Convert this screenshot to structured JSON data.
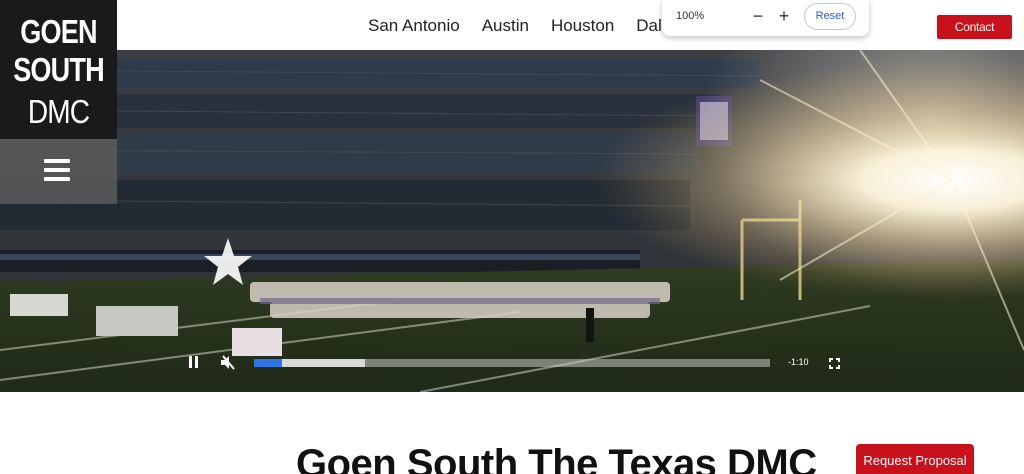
{
  "logo": {
    "line1": "GOEN",
    "line2": "SOUTH",
    "line3": "DMC"
  },
  "nav": {
    "items": [
      "San Antonio",
      "Austin",
      "Houston",
      "Dallas"
    ]
  },
  "zoom": {
    "level": "100%",
    "minus": "−",
    "plus": "+",
    "reset": "Reset"
  },
  "header": {
    "contact": "Contact"
  },
  "video": {
    "time_remaining": "-1:10",
    "progress_played": 0.055,
    "progress_buffered": 0.215,
    "controls": {
      "play": "pause-icon",
      "mute": "muted-speaker-icon",
      "fullscreen": "fullscreen-icon"
    }
  },
  "main": {
    "headline": "Goen South The Texas DMC",
    "cta": "Request Proposal"
  },
  "colors": {
    "brand_red": "#c8111a",
    "progress_blue": "#2f73e6",
    "logo_bg": "#1a1a1a"
  }
}
